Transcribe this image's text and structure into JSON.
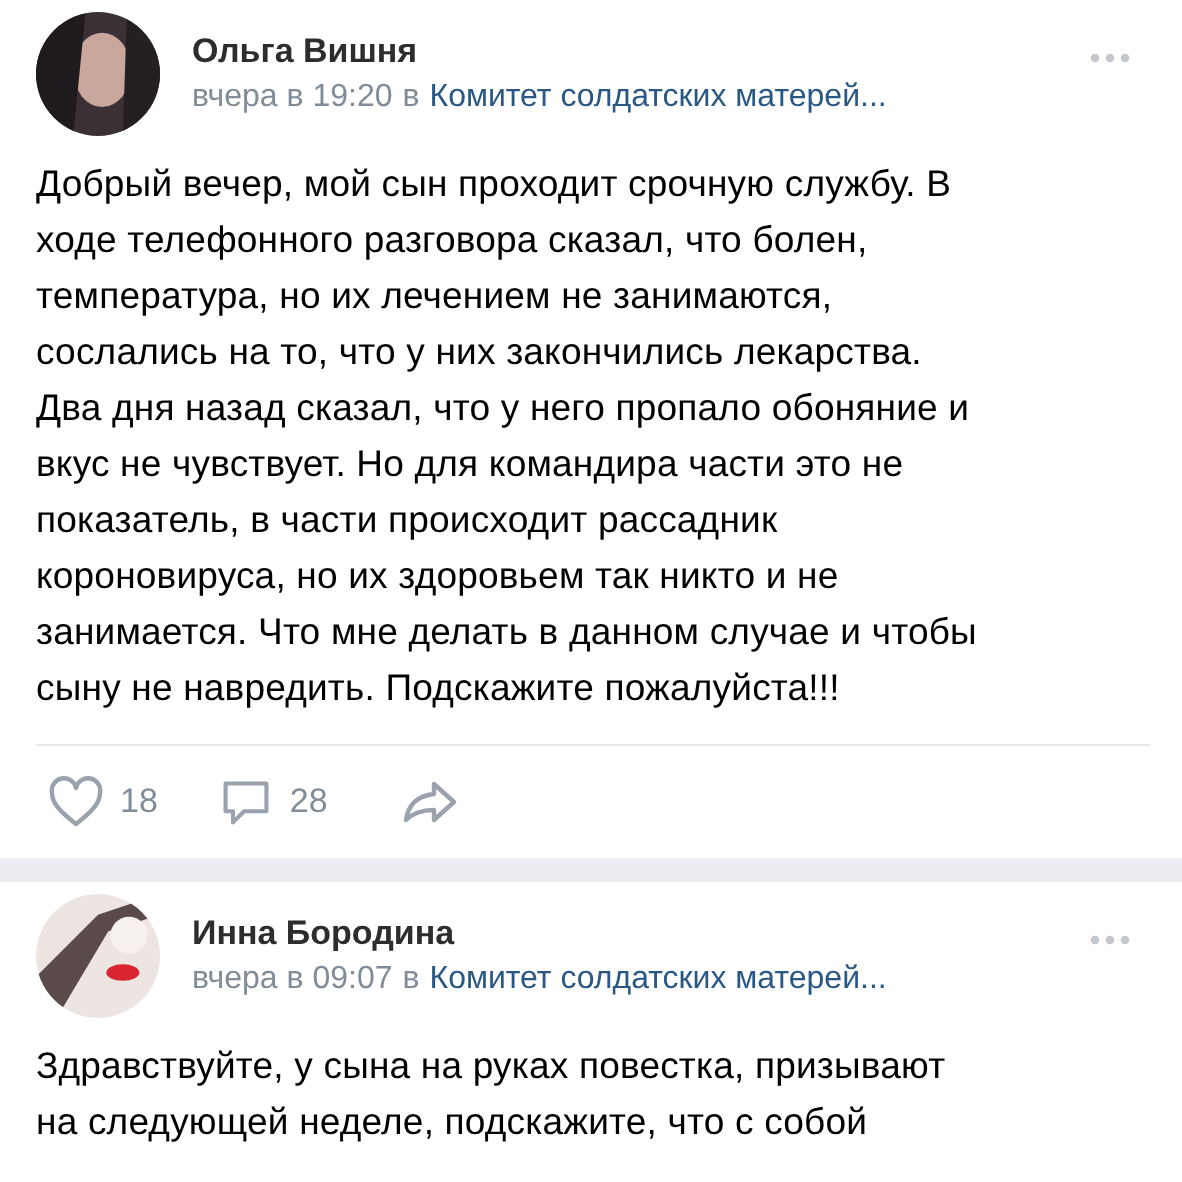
{
  "posts": [
    {
      "author": "Ольга Вишня",
      "time": "вчера в 19:20",
      "in": "в",
      "group": "Комитет солдатских матерей...",
      "text": "Добрый вечер, мой сын проходит срочную службу. В\nходе телефонного разговора сказал, что болен,\nтемпература, но их лечением не занимаются,\nсослались на то, что у них закончились лекарства.\nДва дня назад сказал, что у него пропало обоняние и\nвкус не чувствует. Но для командира части это не\nпоказатель, в части происходит рассадник\nкороновируса, но их здоровьем так никто и не\nзанимается. Что мне делать в данном случае и чтобы\nсыну не навредить. Подскажите пожалуйста!!!",
      "likes": "18",
      "comments": "28"
    },
    {
      "author": "Инна Бородина",
      "time": "вчера в 09:07",
      "in": "в",
      "group": "Комитет солдатских матерей...",
      "text": "Здравствуйте, у сына на руках повестка, призывают\nна следующей неделе, подскажите, что с собой"
    }
  ]
}
